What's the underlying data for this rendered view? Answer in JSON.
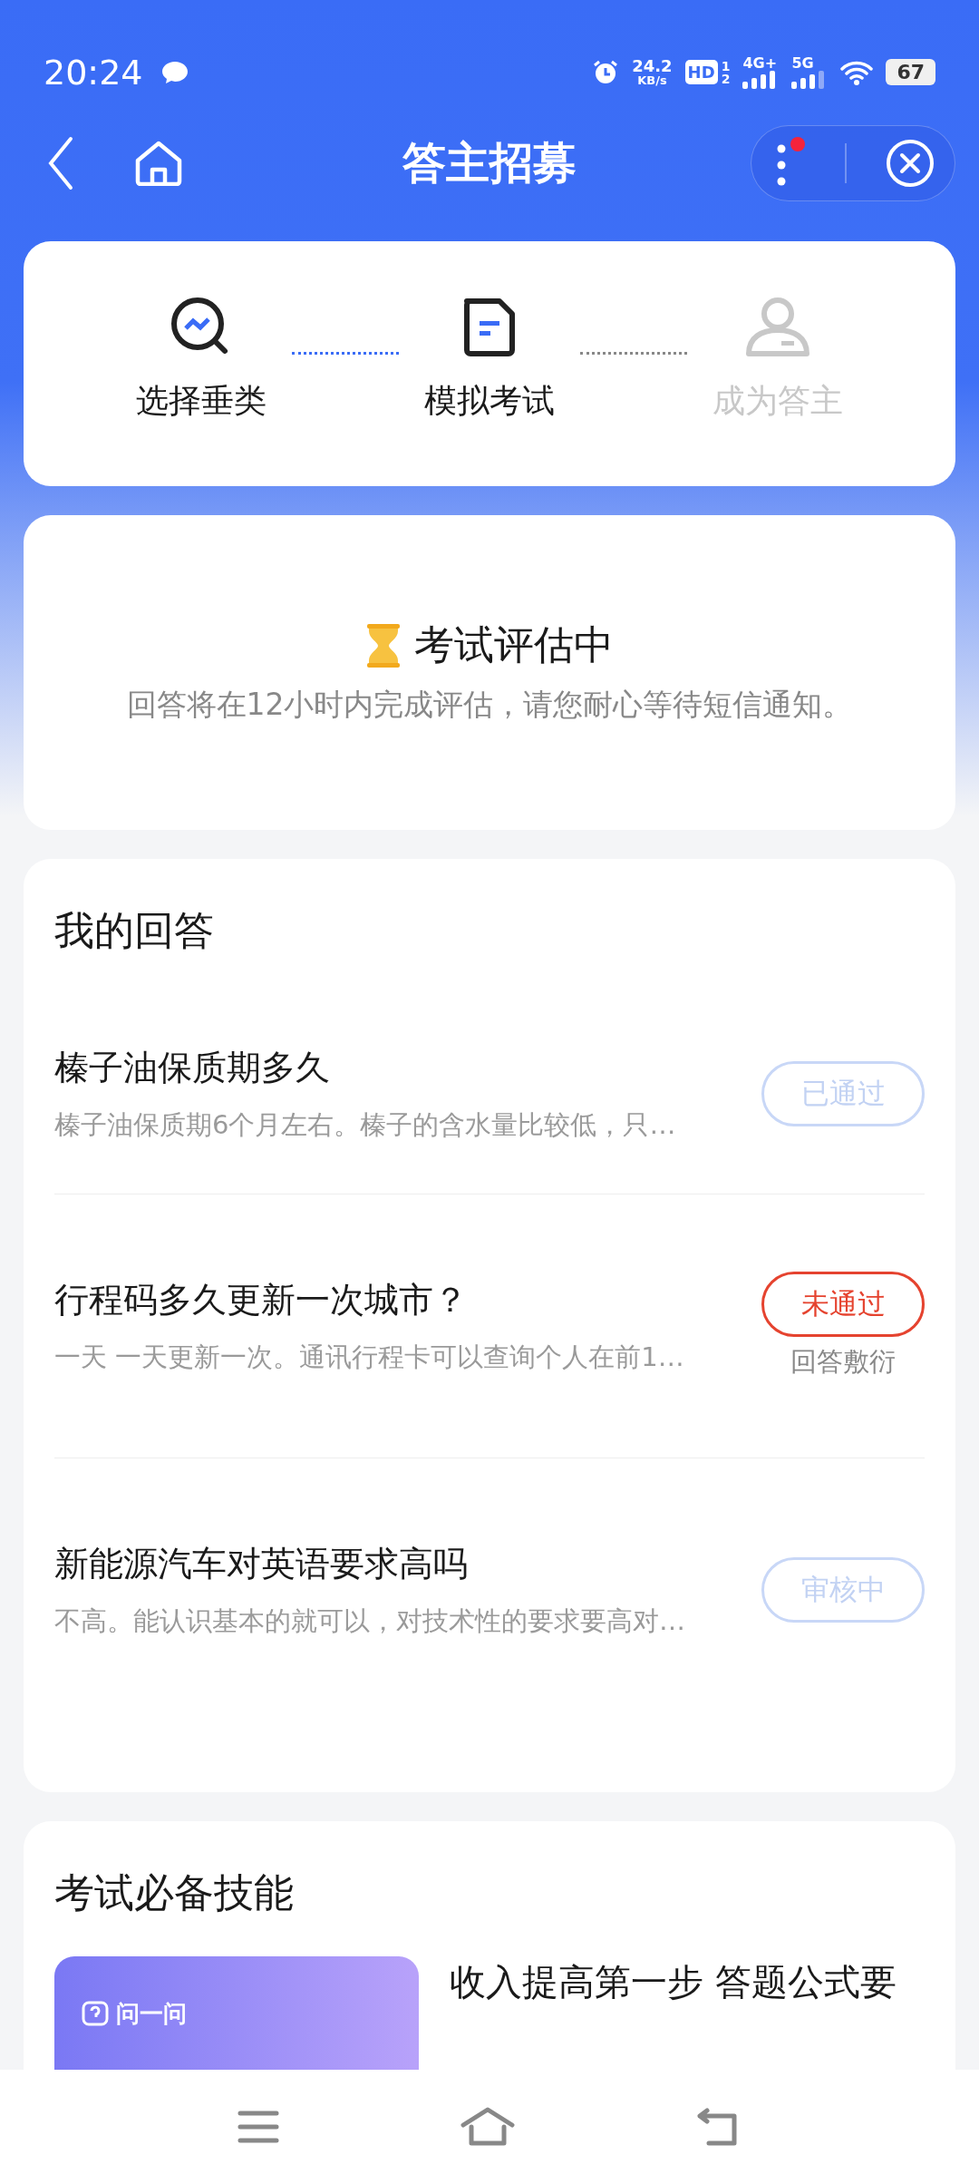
{
  "status_bar": {
    "time": "20:24",
    "speed_value": "24.2",
    "speed_unit": "KB/s",
    "hd": "HD",
    "sim1": "1",
    "sim2": "2",
    "network1": "4G+",
    "network2": "5G",
    "battery": "67"
  },
  "header": {
    "title": "答主招募",
    "menu_badge": true
  },
  "steps": [
    {
      "label": "选择垂类",
      "active": true
    },
    {
      "label": "模拟考试",
      "active": true
    },
    {
      "label": "成为答主",
      "active": false
    }
  ],
  "evaluation": {
    "title": "考试评估中",
    "message": "回答将在12小时内完成评估，请您耐心等待短信通知。"
  },
  "answers": {
    "title": "我的回答",
    "items": [
      {
        "question": "榛子油保质期多久",
        "snippet": "榛子油保质期6个月左右。榛子的含水量比较低，只…",
        "status": "已通过",
        "kind": "passed"
      },
      {
        "question": "行程码多久更新一次城市？",
        "snippet": "一天 一天更新一次。通讯行程卡可以查询个人在前1…",
        "status": "未通过",
        "kind": "failed",
        "reason": "回答敷衍"
      },
      {
        "question": "新能源汽车对英语要求高吗",
        "snippet": "不高。能认识基本的就可以，对技术性的要求要高对…",
        "status": "审核中",
        "kind": "reviewing"
      }
    ]
  },
  "skills": {
    "title": "考试必备技能",
    "items": [
      {
        "thumb_label": "问一问",
        "title": "收入提高第一步 答题公式要"
      }
    ]
  }
}
